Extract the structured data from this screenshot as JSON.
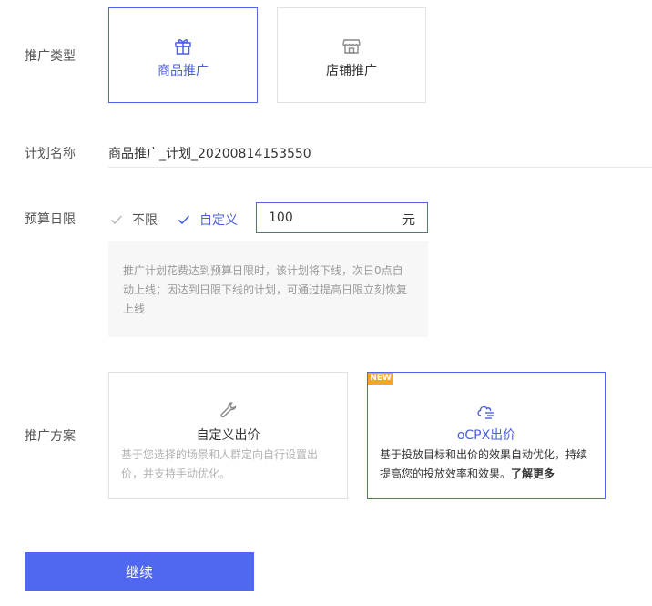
{
  "promotion_type": {
    "label": "推广类型",
    "options": [
      {
        "label": "商品推广",
        "icon": "gift-icon",
        "selected": true
      },
      {
        "label": "店铺推广",
        "icon": "store-icon",
        "selected": false
      }
    ]
  },
  "plan_name": {
    "label": "计划名称",
    "value": "商品推广_计划_20200814153550"
  },
  "budget": {
    "label": "预算日限",
    "options": [
      {
        "label": "不限",
        "selected": false
      },
      {
        "label": "自定义",
        "selected": true
      }
    ],
    "value": "100",
    "unit": "元",
    "notice": "推广计划花费达到预算日限时，该计划将下线，次日0点自动上线；因达到日限下线的计划，可通过提高日限立刻恢复上线"
  },
  "scheme": {
    "label": "推广方案",
    "options": [
      {
        "title": "自定义出价",
        "icon": "wrench-icon",
        "description": "基于您选择的场景和人群定向自行设置出价，并支持手动优化。",
        "selected": false
      },
      {
        "title": "oCPX出价",
        "icon": "smart-cloud-icon",
        "badge": "NEW",
        "description": "基于投放目标和出价的效果自动优化，持续提高您的投放效率和效果。",
        "link": "了解更多",
        "selected": true
      }
    ]
  },
  "actions": {
    "continue_label": "继续"
  },
  "colors": {
    "accent": "#4f66e8",
    "button": "#5068f0",
    "badge": "#f5a623"
  }
}
